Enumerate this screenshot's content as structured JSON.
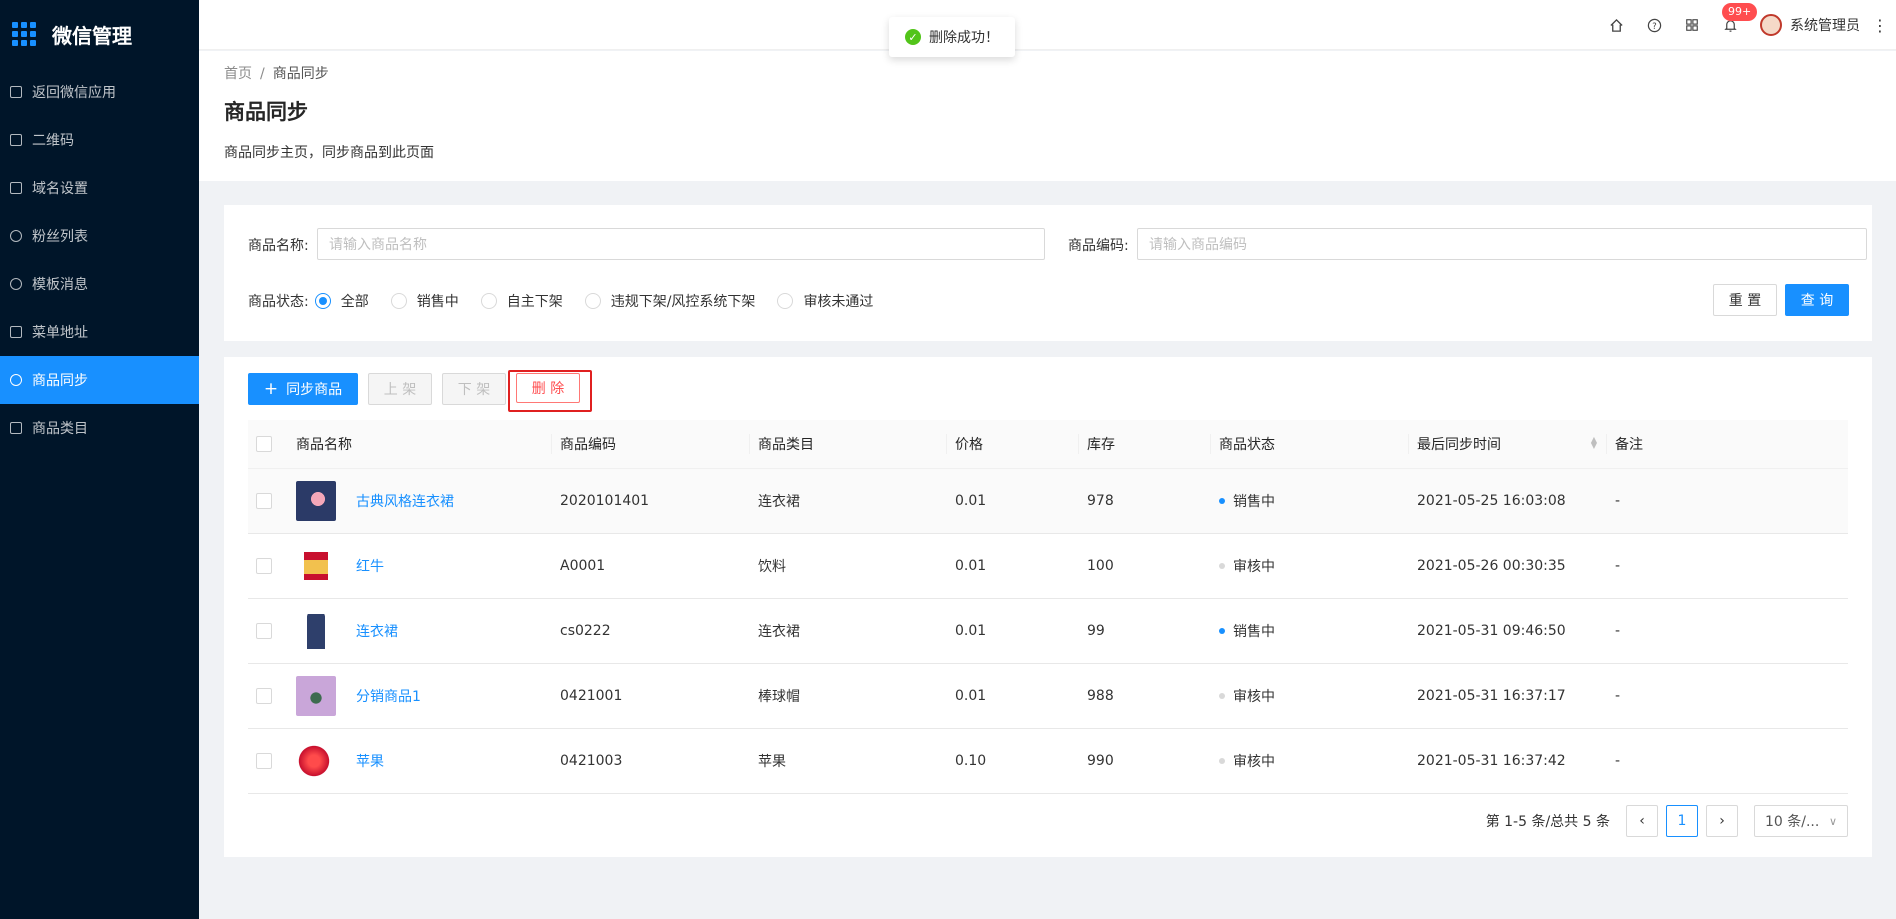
{
  "app": {
    "title": "微信管理"
  },
  "sidebar": {
    "items": [
      {
        "label": "返回微信应用",
        "icon": "back-icon"
      },
      {
        "label": "二维码",
        "icon": "qrcode-icon"
      },
      {
        "label": "域名设置",
        "icon": "domain-icon"
      },
      {
        "label": "粉丝列表",
        "icon": "refresh-icon"
      },
      {
        "label": "模板消息",
        "icon": "message-icon"
      },
      {
        "label": "菜单地址",
        "icon": "menu-address-icon"
      },
      {
        "label": "商品同步",
        "icon": "cloud-icon",
        "active": true
      },
      {
        "label": "商品类目",
        "icon": "list-icon"
      }
    ]
  },
  "header": {
    "notification_count": "99+",
    "username": "系统管理员"
  },
  "toast": {
    "message": "删除成功！"
  },
  "page": {
    "breadcrumb_home": "首页",
    "breadcrumb_sep": "/",
    "breadcrumb_current": "商品同步",
    "title": "商品同步",
    "description": "商品同步主页，同步商品到此页面"
  },
  "filter": {
    "name_label": "商品名称:",
    "name_placeholder": "请输入商品名称",
    "code_label": "商品编码:",
    "code_placeholder": "请输入商品编码",
    "status_label": "商品状态:",
    "status_options": [
      "全部",
      "销售中",
      "自主下架",
      "违规下架/风控系统下架",
      "审核未通过"
    ],
    "status_selected": "全部",
    "reset_label": "重 置",
    "query_label": "查 询"
  },
  "toolbar": {
    "sync_label": "同步商品",
    "on_shelf_label": "上 架",
    "off_shelf_label": "下 架",
    "delete_label": "删 除"
  },
  "table": {
    "columns": [
      "商品名称",
      "商品编码",
      "商品类目",
      "价格",
      "库存",
      "商品状态",
      "最后同步时间",
      "备注"
    ],
    "rows": [
      {
        "name": "古典风格连衣裙",
        "code": "2020101401",
        "category": "连衣裙",
        "price": "0.01",
        "stock": "978",
        "status": "销售中",
        "sync_time": "2021-05-25 16:03:08",
        "remark": "-"
      },
      {
        "name": "红牛",
        "code": "A0001",
        "category": "饮料",
        "price": "0.01",
        "stock": "100",
        "status": "审核中",
        "sync_time": "2021-05-26 00:30:35",
        "remark": "-"
      },
      {
        "name": "连衣裙",
        "code": "cs0222",
        "category": "连衣裙",
        "price": "0.01",
        "stock": "99",
        "status": "销售中",
        "sync_time": "2021-05-31 09:46:50",
        "remark": "-"
      },
      {
        "name": "分销商品1",
        "code": "0421001",
        "category": "棒球帽",
        "price": "0.01",
        "stock": "988",
        "status": "审核中",
        "sync_time": "2021-05-31 16:37:17",
        "remark": "-"
      },
      {
        "name": "苹果",
        "code": "0421003",
        "category": "苹果",
        "price": "0.10",
        "stock": "990",
        "status": "审核中",
        "sync_time": "2021-05-31 16:37:42",
        "remark": "-"
      }
    ]
  },
  "pagination": {
    "summary": "第 1-5 条/总共 5 条",
    "current_page": "1",
    "page_size": "10 条/..."
  },
  "colors": {
    "sidebar_bg": "#001529",
    "accent": "#1890ff",
    "danger": "#ff4d4f",
    "success": "#52c41a",
    "status_selling": "#1890ff",
    "status_reviewing": "#d9d9d9"
  }
}
